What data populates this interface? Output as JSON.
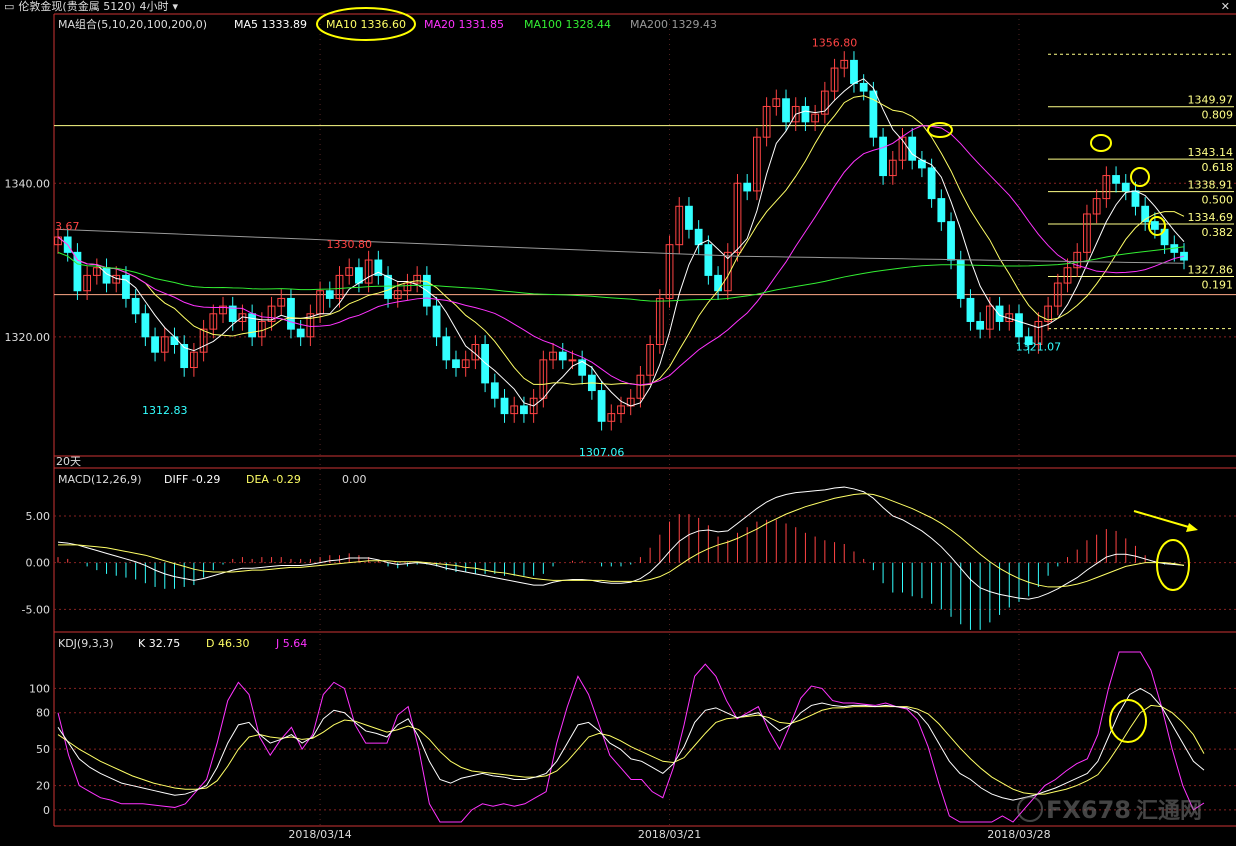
{
  "window": {
    "title": "伦敦金现(贵金属 5120)",
    "period": "4小时",
    "close_icon": "close-icon"
  },
  "price_panel": {
    "ma_label": "MA组合(5,10,20,100,200,0)",
    "ma5": "MA5 1333.89",
    "ma10": "MA10 1336.60",
    "ma20": "MA20 1331.85",
    "ma100": "MA100 1328.44",
    "ma200": "MA200 1329.43",
    "left_cut_label": "3.67",
    "period_days_label": "20天",
    "colors": {
      "ma5": "#ffffff",
      "ma10": "#ffff66",
      "ma20": "#ff33ff",
      "ma100": "#33ee33",
      "ma200": "#999999",
      "up": "#ff4444",
      "down": "#33ffff",
      "hline": "#ffff88",
      "annot": "#ffff00"
    }
  },
  "macd_panel": {
    "label": "MACD(12,26,9)",
    "diff": "DIFF  -0.29",
    "dea": "DEA  -0.29",
    "macd": "0.00"
  },
  "kdj_panel": {
    "label": "KDJ(9,3,3)",
    "k": "K  32.75",
    "d": "D  46.30",
    "j": "J  5.64"
  },
  "watermark": {
    "text": "FX678",
    "cn": "汇通网"
  },
  "chart_data": [
    {
      "type": "candlestick",
      "title": "",
      "ylim": [
        1305,
        1361
      ],
      "y_ticks": [
        1320,
        1340
      ],
      "y_tick_labels": [
        "1320.00",
        "1340.00"
      ],
      "x_tick_labels": [
        "2018/03/14",
        "2018/03/21",
        "2018/03/28"
      ],
      "price_labels": [
        {
          "text": "1356.80",
          "value": 1356.8
        },
        {
          "text": "1330.80",
          "value": 1330.8
        },
        {
          "text": "1312.83",
          "value": 1312.83
        },
        {
          "text": "1307.06",
          "value": 1307.06
        },
        {
          "text": "1321.07",
          "value": 1321.07
        }
      ],
      "fib_levels": [
        {
          "price": "1349.97",
          "ratio": "0.809",
          "value": 1349.97
        },
        {
          "price": "1343.14",
          "ratio": "0.618",
          "value": 1343.14
        },
        {
          "price": "1338.91",
          "ratio": "0.500",
          "value": 1338.91
        },
        {
          "price": "1334.69",
          "ratio": "0.382",
          "value": 1334.69
        },
        {
          "price": "1327.86",
          "ratio": "0.191",
          "value": 1327.86
        }
      ],
      "closes": [
        1333,
        1331,
        1326,
        1328,
        1329,
        1327,
        1328,
        1325,
        1323,
        1320,
        1318,
        1320,
        1319,
        1316,
        1318,
        1321,
        1323,
        1324,
        1322,
        1323,
        1320,
        1322,
        1324,
        1325,
        1321,
        1320,
        1323,
        1326,
        1325,
        1328,
        1329,
        1327,
        1330,
        1328,
        1325,
        1326,
        1327,
        1328,
        1324,
        1320,
        1317,
        1316,
        1317,
        1319,
        1314,
        1312,
        1310,
        1311,
        1310,
        1312,
        1317,
        1318,
        1317,
        1317,
        1315,
        1313,
        1309,
        1310,
        1311,
        1312,
        1315,
        1319,
        1325,
        1332,
        1337,
        1334,
        1332,
        1328,
        1326,
        1331,
        1340,
        1339,
        1346,
        1350,
        1351,
        1348,
        1350,
        1348,
        1349,
        1352,
        1355,
        1356,
        1353,
        1352,
        1346,
        1341,
        1343,
        1346,
        1343,
        1342,
        1338,
        1335,
        1330,
        1325,
        1322,
        1321,
        1324,
        1322,
        1323,
        1320,
        1319,
        1322,
        1324,
        1327,
        1329,
        1331,
        1336,
        1338,
        1341,
        1340,
        1339,
        1337,
        1335,
        1334,
        1332,
        1331,
        1330
      ]
    },
    {
      "type": "bar+line",
      "title": "MACD(12,26,9)",
      "ylim": [
        -7,
        8
      ],
      "y_ticks": [
        5,
        0,
        -5
      ],
      "y_tick_labels": [
        "5.00",
        "0.00",
        "-5.00"
      ],
      "diff": [
        2.2,
        2.1,
        1.9,
        1.6,
        1.3,
        1.0,
        0.7,
        0.4,
        0.1,
        -0.3,
        -0.8,
        -1.2,
        -1.5,
        -1.7,
        -1.9,
        -1.7,
        -1.4,
        -1.1,
        -0.8,
        -0.6,
        -0.6,
        -0.5,
        -0.4,
        -0.3,
        -0.3,
        -0.3,
        -0.2,
        0.0,
        0.2,
        0.3,
        0.5,
        0.5,
        0.5,
        0.3,
        0.0,
        -0.2,
        -0.1,
        0.0,
        -0.1,
        -0.3,
        -0.6,
        -0.8,
        -1.0,
        -1.2,
        -1.4,
        -1.6,
        -1.8,
        -2.0,
        -2.2,
        -2.4,
        -2.4,
        -2.1,
        -1.9,
        -1.8,
        -1.8,
        -1.9,
        -2.1,
        -2.2,
        -2.2,
        -2.1,
        -1.7,
        -1.0,
        0.0,
        1.2,
        2.3,
        3.0,
        3.4,
        3.5,
        3.3,
        3.4,
        4.2,
        5.0,
        5.8,
        6.5,
        7.0,
        7.3,
        7.5,
        7.6,
        7.7,
        7.8,
        8.0,
        8.1,
        7.9,
        7.6,
        6.9,
        5.9,
        5.0,
        4.6,
        4.0,
        3.4,
        2.6,
        1.7,
        0.6,
        -0.6,
        -1.8,
        -2.7,
        -3.1,
        -3.4,
        -3.6,
        -3.8,
        -3.9,
        -3.7,
        -3.3,
        -2.8,
        -2.2,
        -1.6,
        -0.8,
        -0.1,
        0.6,
        0.9,
        0.9,
        0.7,
        0.4,
        0.1,
        -0.1,
        -0.2,
        -0.29
      ],
      "dea": [
        1.9,
        1.9,
        1.9,
        1.8,
        1.7,
        1.6,
        1.4,
        1.2,
        1.0,
        0.8,
        0.5,
        0.2,
        -0.1,
        -0.4,
        -0.7,
        -0.9,
        -1.0,
        -1.0,
        -1.0,
        -0.9,
        -0.8,
        -0.8,
        -0.7,
        -0.6,
        -0.5,
        -0.5,
        -0.4,
        -0.3,
        -0.2,
        -0.1,
        0.0,
        0.1,
        0.2,
        0.2,
        0.2,
        0.1,
        0.1,
        0.1,
        0.0,
        -0.1,
        -0.2,
        -0.3,
        -0.5,
        -0.6,
        -0.8,
        -1.0,
        -1.1,
        -1.3,
        -1.5,
        -1.7,
        -1.8,
        -1.9,
        -1.9,
        -1.9,
        -1.9,
        -1.9,
        -1.9,
        -2.0,
        -2.0,
        -2.0,
        -2.0,
        -1.8,
        -1.5,
        -1.0,
        -0.3,
        0.4,
        1.0,
        1.5,
        1.9,
        2.2,
        2.6,
        3.1,
        3.6,
        4.2,
        4.7,
        5.2,
        5.6,
        6.0,
        6.3,
        6.6,
        6.9,
        7.1,
        7.3,
        7.4,
        7.3,
        7.0,
        6.6,
        6.2,
        5.8,
        5.3,
        4.8,
        4.2,
        3.5,
        2.7,
        1.8,
        0.9,
        0.1,
        -0.6,
        -1.2,
        -1.7,
        -2.1,
        -2.4,
        -2.6,
        -2.6,
        -2.5,
        -2.3,
        -2.0,
        -1.6,
        -1.2,
        -0.8,
        -0.4,
        -0.2,
        0.0,
        0.0,
        0.0,
        -0.1,
        -0.29
      ]
    },
    {
      "type": "line",
      "title": "KDJ(9,3,3)",
      "ylim": [
        -10,
        130
      ],
      "y_ticks": [
        100,
        80,
        50,
        20,
        0
      ],
      "y_tick_labels": [
        "100",
        "80",
        "50",
        "20",
        "0"
      ],
      "k": [
        68,
        55,
        42,
        35,
        30,
        26,
        22,
        20,
        18,
        16,
        14,
        12,
        13,
        16,
        20,
        35,
        55,
        70,
        72,
        62,
        55,
        58,
        62,
        55,
        60,
        75,
        82,
        80,
        72,
        65,
        63,
        60,
        70,
        75,
        60,
        40,
        25,
        22,
        26,
        28,
        30,
        28,
        27,
        25,
        25,
        27,
        30,
        40,
        55,
        70,
        72,
        65,
        55,
        50,
        42,
        40,
        35,
        30,
        38,
        52,
        72,
        82,
        84,
        80,
        76,
        78,
        80,
        72,
        65,
        70,
        80,
        86,
        88,
        86,
        85,
        86,
        86,
        85,
        86,
        85,
        84,
        80,
        70,
        55,
        40,
        30,
        25,
        18,
        13,
        10,
        8,
        10,
        12,
        15,
        18,
        22,
        26,
        30,
        40,
        60,
        80,
        95,
        100,
        95,
        85,
        70,
        55,
        40,
        32.75
      ],
      "d": [
        62,
        56,
        50,
        45,
        40,
        36,
        32,
        28,
        25,
        22,
        20,
        18,
        17,
        17,
        18,
        24,
        36,
        50,
        60,
        62,
        60,
        59,
        60,
        58,
        59,
        64,
        70,
        74,
        73,
        70,
        67,
        64,
        66,
        69,
        66,
        58,
        48,
        40,
        35,
        32,
        31,
        30,
        29,
        28,
        27,
        27,
        28,
        32,
        40,
        50,
        60,
        63,
        61,
        57,
        52,
        48,
        44,
        40,
        39,
        43,
        53,
        63,
        72,
        75,
        76,
        77,
        78,
        76,
        72,
        71,
        74,
        78,
        82,
        84,
        84,
        85,
        85,
        85,
        85,
        85,
        85,
        83,
        79,
        71,
        61,
        51,
        42,
        34,
        27,
        22,
        17,
        14,
        13,
        13,
        15,
        17,
        20,
        24,
        29,
        40,
        53,
        67,
        80,
        86,
        85,
        80,
        72,
        62,
        46.3
      ],
      "j": [
        80,
        45,
        20,
        15,
        10,
        8,
        5,
        5,
        5,
        4,
        3,
        2,
        5,
        15,
        25,
        55,
        90,
        105,
        95,
        60,
        45,
        58,
        68,
        50,
        62,
        95,
        105,
        100,
        70,
        55,
        55,
        55,
        78,
        85,
        50,
        5,
        -15,
        -18,
        -10,
        0,
        5,
        3,
        5,
        3,
        5,
        10,
        15,
        55,
        85,
        110,
        95,
        70,
        45,
        35,
        25,
        25,
        15,
        10,
        35,
        70,
        110,
        120,
        110,
        90,
        75,
        80,
        85,
        65,
        50,
        70,
        92,
        102,
        100,
        90,
        88,
        88,
        87,
        86,
        88,
        85,
        83,
        74,
        52,
        22,
        -5,
        -15,
        -10,
        -15,
        -10,
        -5,
        -10,
        0,
        10,
        20,
        25,
        32,
        38,
        42,
        62,
        100,
        134,
        150,
        140,
        115,
        85,
        50,
        20,
        0,
        5.64
      ]
    }
  ]
}
